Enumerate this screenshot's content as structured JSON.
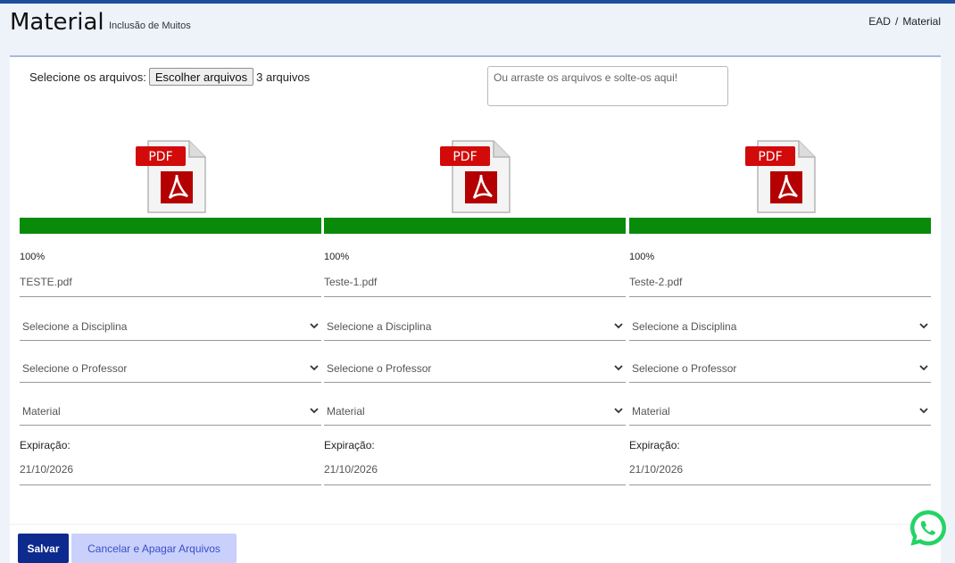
{
  "header": {
    "title": "Material",
    "subtitle": "Inclusão de Muitos",
    "breadcrumb": [
      "EAD",
      "Material"
    ],
    "breadcrumb_sep": "/"
  },
  "upload": {
    "label": "Selecione os arquivos:",
    "button_label": "Escolher arquivos",
    "status": "3 arquivos",
    "drop_zone_text": "Ou arraste os arquivos e solte-os aqui!"
  },
  "files": [
    {
      "icon": "pdf-icon",
      "icon_text": "PDF",
      "progress": 1.0,
      "progress_label": "100%",
      "name": "TESTE.pdf",
      "disciplina": "Selecione a Disciplina",
      "professor": "Selecione o Professor",
      "tipo": "Material",
      "expiracao_label": "Expiração:",
      "expiracao": "21/10/2026"
    },
    {
      "icon": "pdf-icon",
      "icon_text": "PDF",
      "progress": 1.0,
      "progress_label": "100%",
      "name": "Teste-1.pdf",
      "disciplina": "Selecione a Disciplina",
      "professor": "Selecione o Professor",
      "tipo": "Material",
      "expiracao_label": "Expiração:",
      "expiracao": "21/10/2026"
    },
    {
      "icon": "pdf-icon",
      "icon_text": "PDF",
      "progress": 1.0,
      "progress_label": "100%",
      "name": "Teste-2.pdf",
      "disciplina": "Selecione a Disciplina",
      "professor": "Selecione o Professor",
      "tipo": "Material",
      "expiracao_label": "Expiração:",
      "expiracao": "21/10/2026"
    }
  ],
  "actions": {
    "save_label": "Salvar",
    "cancel_label": "Cancelar e Apagar Arquivos"
  },
  "floating": {
    "icon": "whatsapp-icon"
  },
  "colors": {
    "progress": "#0a8a0a",
    "save_button": "#0d2a8e",
    "cancel_button": "#c9d0fb",
    "pdf_red": "#c00000",
    "whatsapp": "#25d366"
  }
}
